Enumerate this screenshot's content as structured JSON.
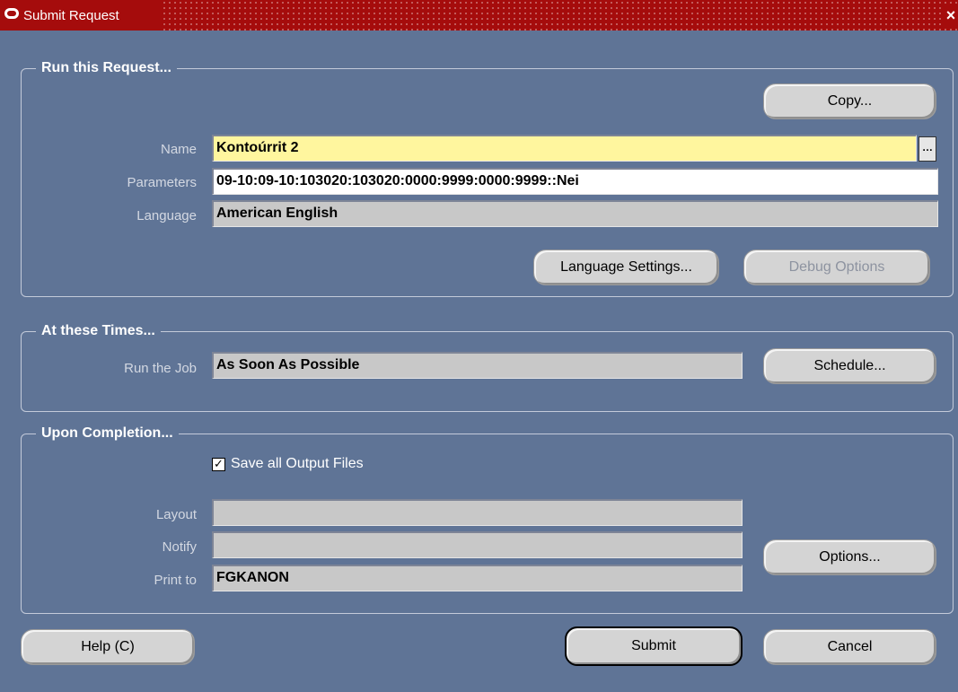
{
  "window": {
    "title": "Submit Request",
    "close_glyph": "×"
  },
  "run_request": {
    "group_title": "Run this Request...",
    "copy_button": "Copy...",
    "name_label": "Name",
    "name_value": "Kontoúrrit 2",
    "lov_glyph": "…",
    "parameters_label": "Parameters",
    "parameters_value": "09-10:09-10:103020:103020:0000:9999:0000:9999::Nei",
    "language_label": "Language",
    "language_value": "American English",
    "language_settings_button": "Language Settings...",
    "debug_options_button": "Debug Options"
  },
  "times": {
    "group_title": "At these Times...",
    "run_job_label": "Run the Job",
    "run_job_value": "As Soon As Possible",
    "schedule_button": "Schedule..."
  },
  "completion": {
    "group_title": "Upon Completion...",
    "save_output_checked": true,
    "check_glyph": "✓",
    "save_output_label": "Save all Output Files",
    "layout_label": "Layout",
    "layout_value": "",
    "notify_label": "Notify",
    "notify_value": "",
    "print_to_label": "Print to",
    "print_to_value": "FGKANON",
    "options_button": "Options..."
  },
  "footer": {
    "help_button": "Help (C)",
    "submit_button": "Submit",
    "cancel_button": "Cancel"
  },
  "colors": {
    "background": "#5f7496",
    "titlebar": "#a50c0c",
    "required_field": "#fff69e"
  }
}
